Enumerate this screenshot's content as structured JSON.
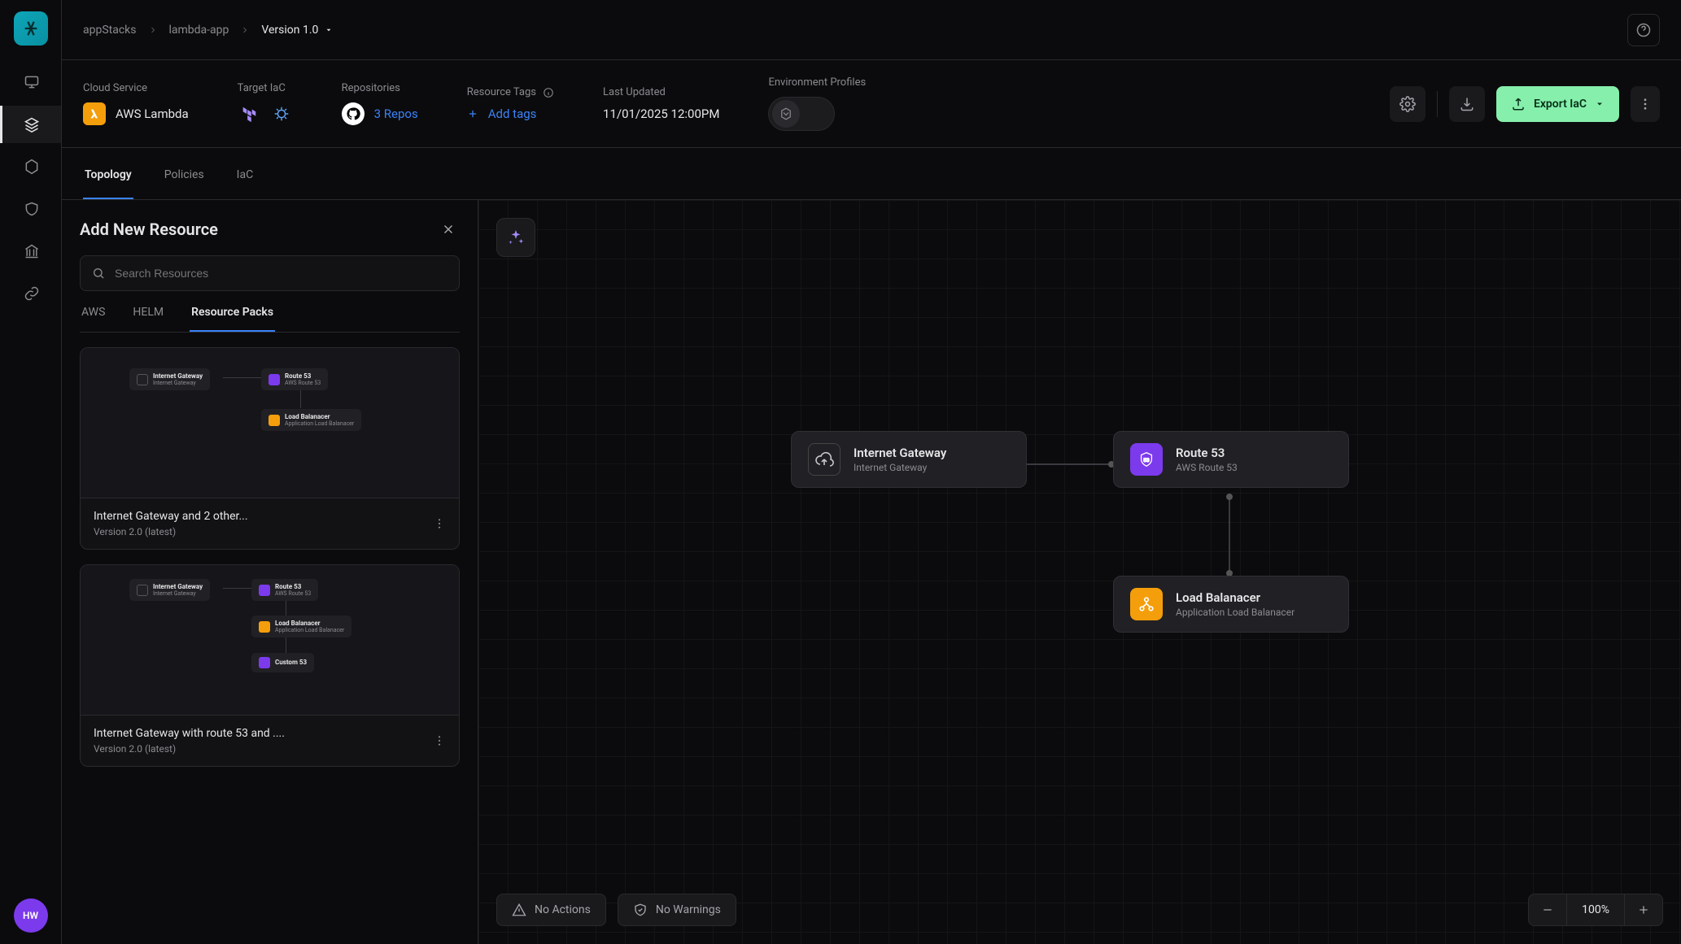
{
  "rail": {
    "avatar": "HW"
  },
  "breadcrumbs": {
    "items": [
      "appStacks",
      "lambda-app"
    ],
    "current": "Version 1.0"
  },
  "info": {
    "cloud_service_label": "Cloud Service",
    "cloud_service_value": "AWS Lambda",
    "target_iac_label": "Target IaC",
    "repos_label": "Repositories",
    "repos_value": "3 Repos",
    "tags_label": "Resource Tags",
    "tags_action": "Add tags",
    "updated_label": "Last Updated",
    "updated_value": "11/01/2025 12:00PM",
    "env_label": "Environment Profiles",
    "export_label": "Export IaC"
  },
  "tabs": {
    "items": [
      "Topology",
      "Policies",
      "IaC"
    ],
    "active": 0
  },
  "panel": {
    "title": "Add New Resource",
    "search_placeholder": "Search Resources",
    "subtabs": [
      "AWS",
      "HELM",
      "Resource Packs"
    ],
    "subtab_active": 2,
    "cards": [
      {
        "title": "Internet Gateway and 2 other...",
        "version": "Version 2.0 (latest)",
        "preview_nodes": [
          {
            "name": "Internet Gateway",
            "sub": "Internet Gateway",
            "color": "none"
          },
          {
            "name": "Route 53",
            "sub": "AWS Route 53",
            "color": "#7c3aed"
          },
          {
            "name": "Load Balanacer",
            "sub": "Application Load Balanacer",
            "color": "#f59e0b"
          }
        ]
      },
      {
        "title": "Internet Gateway with route 53 and ....",
        "version": "Version 2.0 (latest)",
        "preview_nodes": [
          {
            "name": "Internet Gateway",
            "sub": "Internet Gateway",
            "color": "none"
          },
          {
            "name": "Route 53",
            "sub": "AWS Route 53",
            "color": "#7c3aed"
          },
          {
            "name": "Load Balanacer",
            "sub": "Application Load Balanacer",
            "color": "#f59e0b"
          },
          {
            "name": "Custom 53",
            "sub": "",
            "color": "#7c3aed"
          }
        ]
      }
    ]
  },
  "canvas": {
    "nodes": [
      {
        "id": "igw",
        "title": "Internet Gateway",
        "sub": "Internet Gateway",
        "icon": "cloud",
        "iconBg": "transparent"
      },
      {
        "id": "r53",
        "title": "Route 53",
        "sub": "AWS Route 53",
        "icon": "53",
        "iconBg": "#7c3aed"
      },
      {
        "id": "lb",
        "title": "Load Balanacer",
        "sub": "Application Load Balanacer",
        "icon": "lb",
        "iconBg": "#f59e0b"
      }
    ]
  },
  "status": {
    "actions": "No Actions",
    "warnings": "No Warnings",
    "zoom": "100%"
  }
}
